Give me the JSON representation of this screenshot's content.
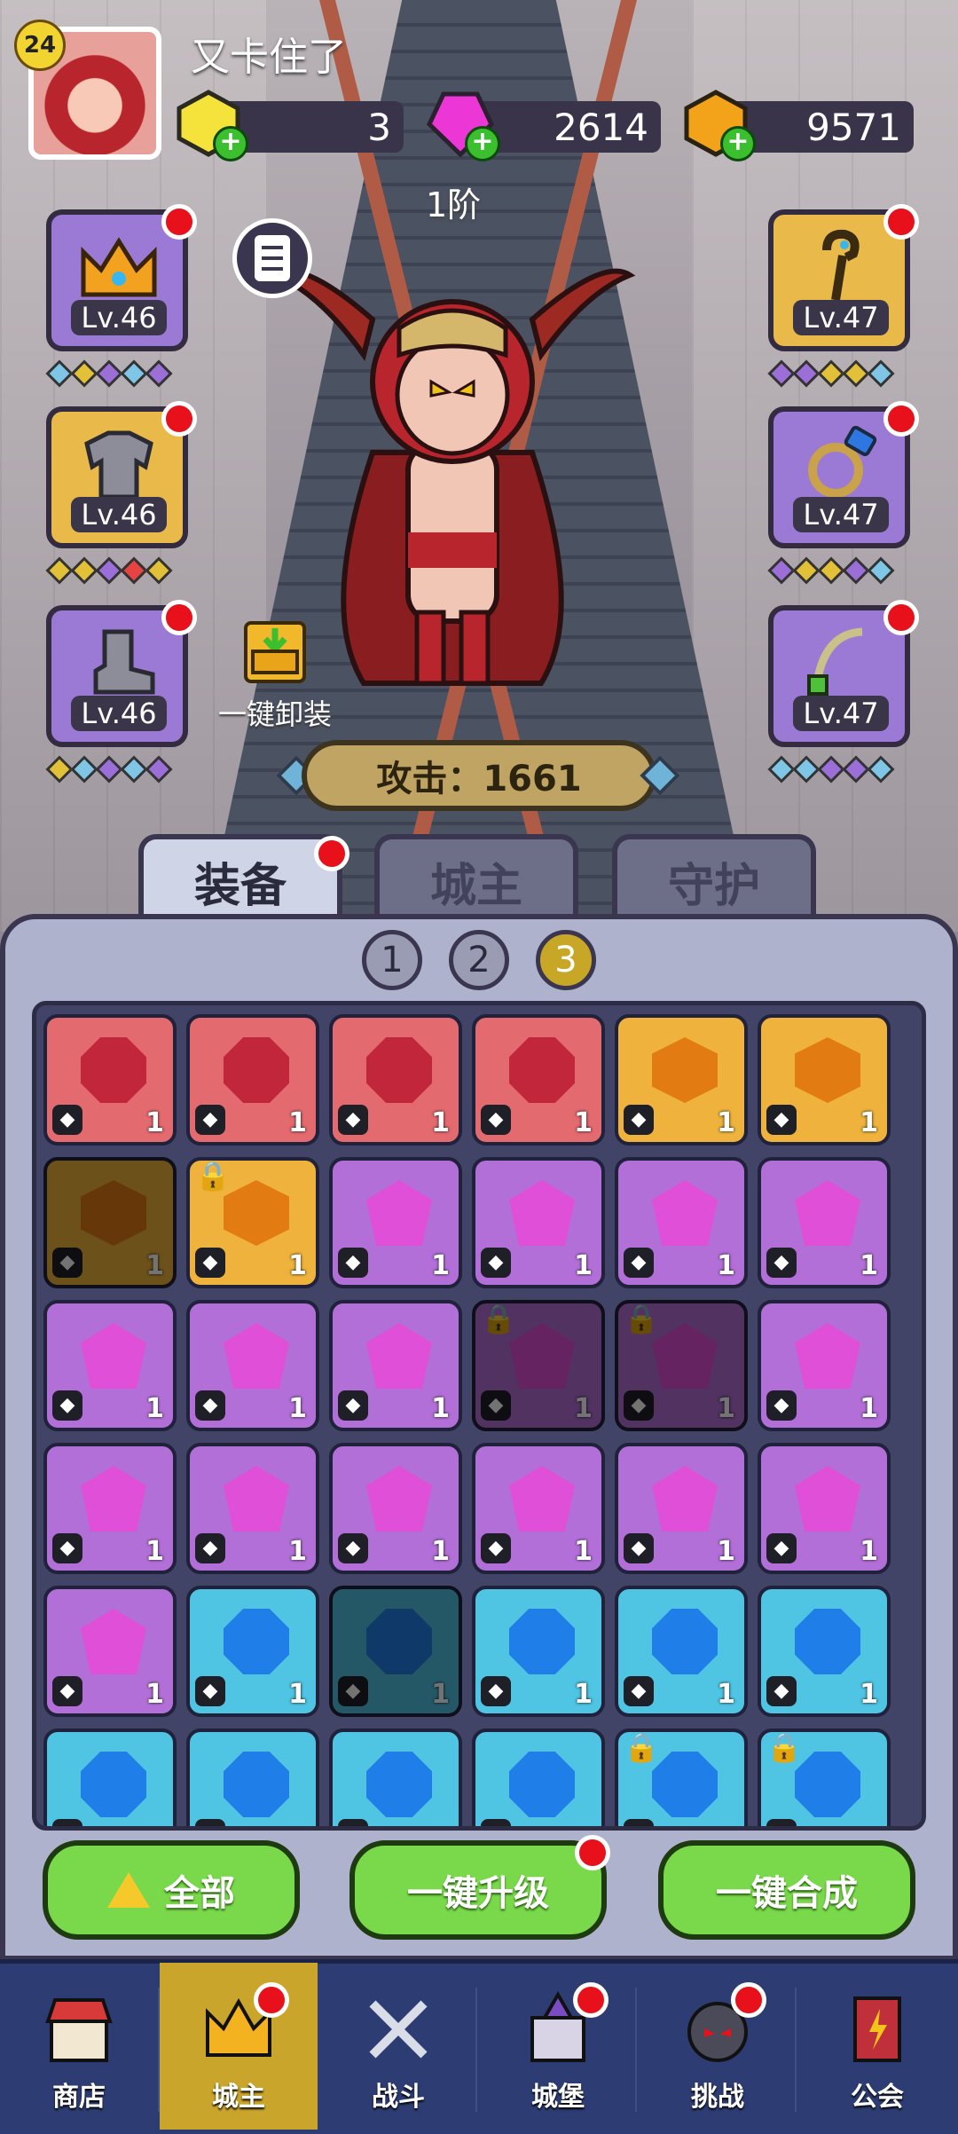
{
  "player": {
    "level": "24",
    "name": "又卡住了"
  },
  "resources": [
    {
      "icon": "yellow-gem-icon",
      "value": "3"
    },
    {
      "icon": "pink-crystal-icon",
      "value": "2614"
    },
    {
      "icon": "gold-coin-icon",
      "value": "9571"
    }
  ],
  "hero": {
    "tier": "1阶",
    "attack": "攻击：1661",
    "unequip_label": "一键卸装"
  },
  "left_slots": [
    {
      "level": "Lv.46",
      "icon": "crown-icon",
      "color": "purple"
    },
    {
      "level": "Lv.46",
      "icon": "armor-icon",
      "color": "gold"
    },
    {
      "level": "Lv.46",
      "icon": "boots-icon",
      "color": "purple"
    }
  ],
  "right_slots": [
    {
      "level": "Lv.47",
      "icon": "staff-icon",
      "color": "gold"
    },
    {
      "level": "Lv.47",
      "icon": "ring-icon",
      "color": "purple"
    },
    {
      "level": "Lv.47",
      "icon": "necklace-icon",
      "color": "purple"
    }
  ],
  "tabs": [
    {
      "label": "装备",
      "active": true
    },
    {
      "label": "城主",
      "active": false
    },
    {
      "label": "守护",
      "active": false
    }
  ],
  "pages": [
    "1",
    "2",
    "3"
  ],
  "active_page": "3",
  "inventory": [
    {
      "color": "red",
      "qty": "1"
    },
    {
      "color": "red",
      "qty": "1"
    },
    {
      "color": "red",
      "qty": "1"
    },
    {
      "color": "red",
      "qty": "1"
    },
    {
      "color": "orange",
      "qty": "1"
    },
    {
      "color": "orange",
      "qty": "1"
    },
    {
      "color": "orange",
      "qty": "1",
      "dim": true
    },
    {
      "color": "orange",
      "qty": "1",
      "locked": true
    },
    {
      "color": "purple",
      "qty": "1"
    },
    {
      "color": "purple",
      "qty": "1"
    },
    {
      "color": "purple",
      "qty": "1"
    },
    {
      "color": "purple",
      "qty": "1"
    },
    {
      "color": "purple",
      "qty": "1"
    },
    {
      "color": "purple",
      "qty": "1"
    },
    {
      "color": "purple",
      "qty": "1"
    },
    {
      "color": "purple",
      "qty": "1",
      "dim": true,
      "locked": true
    },
    {
      "color": "purple",
      "qty": "1",
      "dim": true,
      "locked": true
    },
    {
      "color": "purple",
      "qty": "1"
    },
    {
      "color": "purple",
      "qty": "1"
    },
    {
      "color": "purple",
      "qty": "1"
    },
    {
      "color": "purple",
      "qty": "1"
    },
    {
      "color": "purple",
      "qty": "1"
    },
    {
      "color": "purple",
      "qty": "1"
    },
    {
      "color": "purple",
      "qty": "1"
    },
    {
      "color": "purple",
      "qty": "1"
    },
    {
      "color": "blue",
      "qty": "1"
    },
    {
      "color": "blue",
      "qty": "1",
      "dim": true
    },
    {
      "color": "blue",
      "qty": "1"
    },
    {
      "color": "blue",
      "qty": "1"
    },
    {
      "color": "blue",
      "qty": "1"
    },
    {
      "color": "blue",
      "qty": ""
    },
    {
      "color": "blue",
      "qty": ""
    },
    {
      "color": "blue",
      "qty": ""
    },
    {
      "color": "blue",
      "qty": ""
    },
    {
      "color": "blue",
      "qty": "",
      "locked": true
    },
    {
      "color": "blue",
      "qty": "",
      "locked": true
    }
  ],
  "actions": [
    {
      "label": "全部",
      "icon": "triangle-icon"
    },
    {
      "label": "一键升级"
    },
    {
      "label": "一键合成"
    }
  ],
  "nav": [
    {
      "label": "商店",
      "icon": "shop-icon"
    },
    {
      "label": "城主",
      "icon": "crown-icon",
      "active": true
    },
    {
      "label": "战斗",
      "icon": "swords-icon"
    },
    {
      "label": "城堡",
      "icon": "castle-icon"
    },
    {
      "label": "挑战",
      "icon": "challenge-icon"
    },
    {
      "label": "公会",
      "icon": "guild-banner-icon"
    }
  ],
  "colors": {
    "accent_green": "#79d94a",
    "notification_red": "#e8101a",
    "nav_bg": "#2d3d73",
    "nav_active": "#c9a52b"
  }
}
